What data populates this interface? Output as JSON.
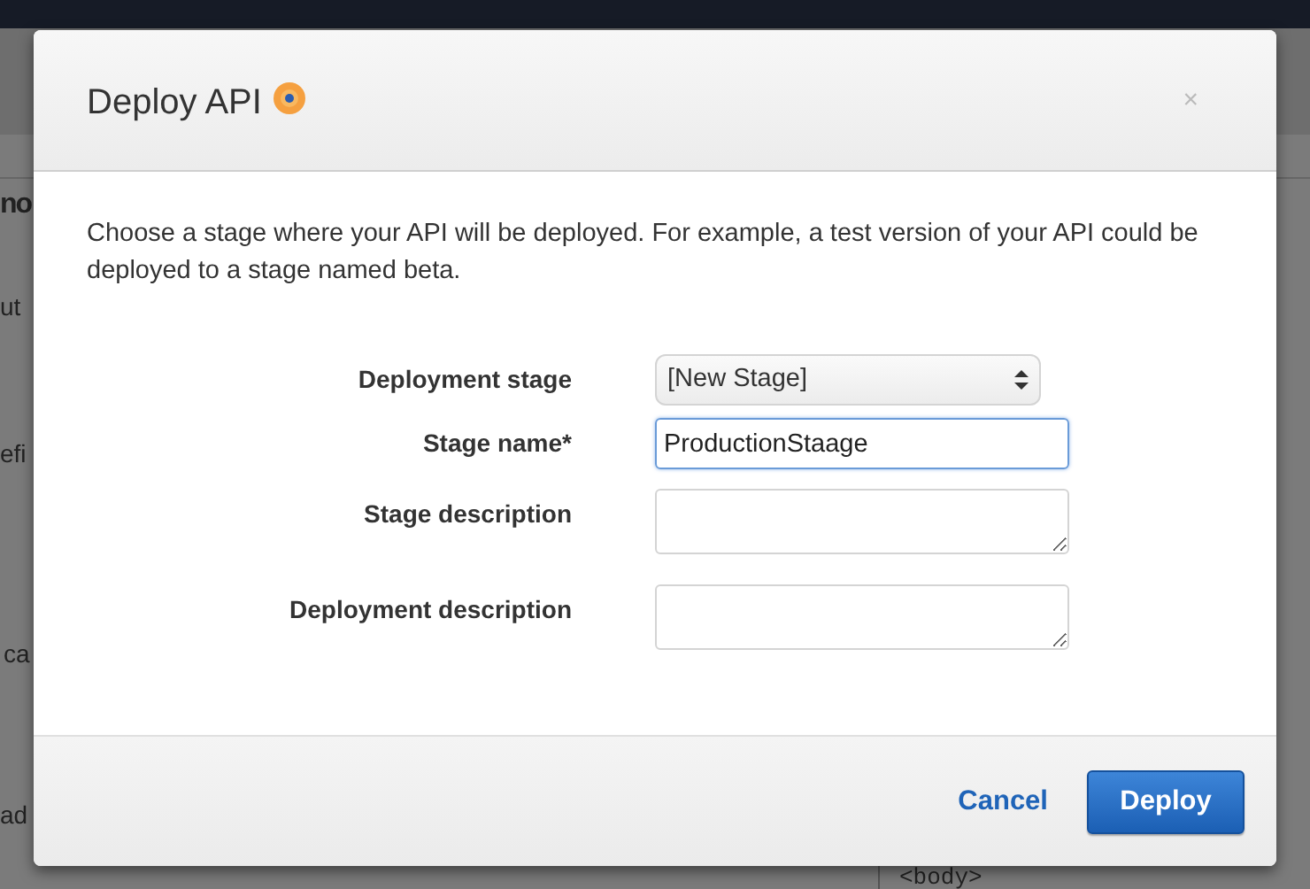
{
  "background": {
    "fragments": [
      {
        "kind": "heading",
        "text": "no"
      },
      {
        "kind": "text",
        "text": "ut"
      },
      {
        "kind": "text",
        "text": "efi"
      },
      {
        "kind": "text",
        "text": "ca"
      },
      {
        "kind": "text",
        "text": "ad"
      },
      {
        "kind": "code",
        "text": "<body>"
      }
    ]
  },
  "modal": {
    "title": "Deploy API",
    "close": "×",
    "description": "Choose a stage where your API will be deployed. For example, a test version of your API could be deployed to a stage named beta.",
    "fields": [
      {
        "kind": "select",
        "label": "Deployment stage",
        "value": "[New Stage]",
        "focused": false
      },
      {
        "kind": "input",
        "label": "Stage name*",
        "value": "ProductionStaage",
        "focused": true
      },
      {
        "kind": "textarea",
        "label": "Stage description",
        "focused": false
      },
      {
        "kind": "textarea",
        "label": "Deployment description",
        "focused": false
      }
    ],
    "buttons": [
      {
        "kind": "link",
        "label": "Cancel"
      },
      {
        "kind": "primary",
        "label": "Deploy"
      }
    ]
  }
}
